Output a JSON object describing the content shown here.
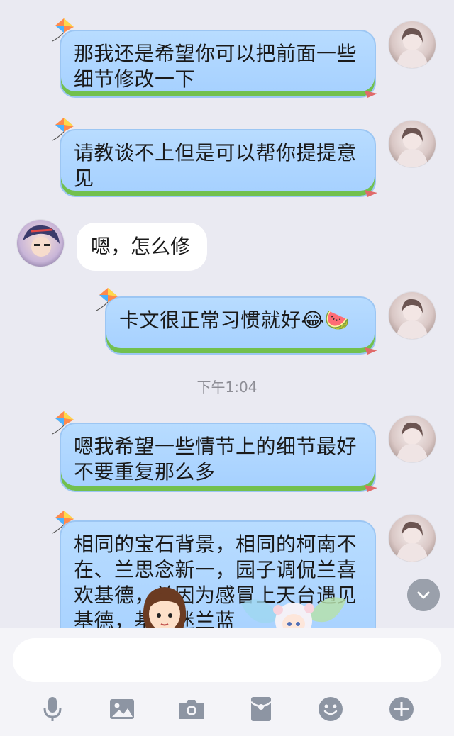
{
  "messages": [
    {
      "side": "me",
      "text": "那我还是希望你可以把前面一些细节修改一下"
    },
    {
      "side": "me",
      "text": "请教谈不上但是可以帮你提提意见"
    },
    {
      "side": "other",
      "text": "嗯，怎么修"
    },
    {
      "side": "me",
      "text": "卡文很正常习惯就好😂🍉"
    },
    {
      "side": "me",
      "text": "嗯我希望一些情节上的细节最好不要重复那么多"
    },
    {
      "side": "me",
      "text": "相同的宝石背景，相同的柯南不在、兰思念新一，园子调侃兰喜欢基德，兰因为感冒上天台遇见基德，基德迷兰蓝"
    }
  ],
  "timestamp": "下午1:04",
  "input": {
    "placeholder": ""
  },
  "toolbar": {
    "icons": [
      "microphone-icon",
      "image-icon",
      "camera-icon",
      "red-packet-icon",
      "emoji-icon",
      "plus-icon"
    ]
  },
  "colors": {
    "bubble_me": "#a8d2ff",
    "bubble_me_border": "#72c04e",
    "bubble_other": "#ffffff",
    "background": "#eaeaf2",
    "toolbar_icon": "#8d95a3"
  }
}
